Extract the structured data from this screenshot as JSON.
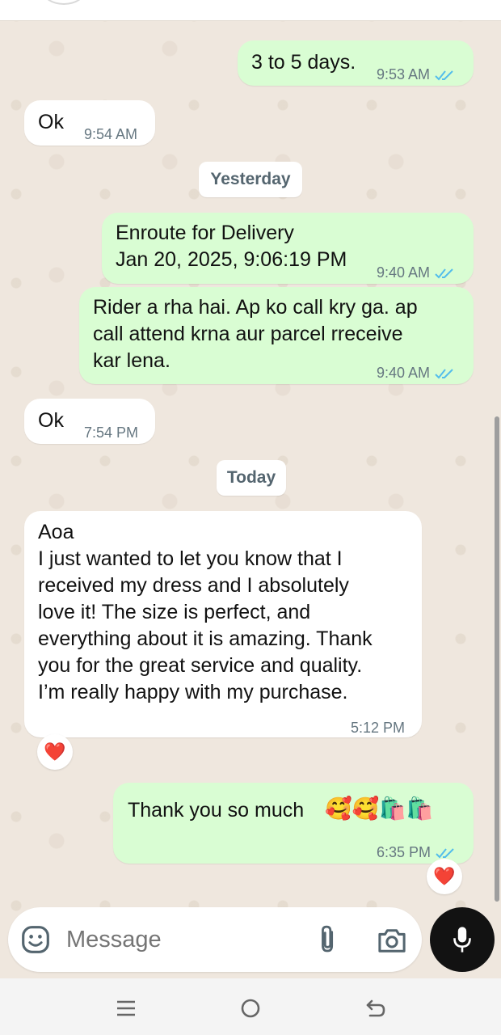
{
  "messages": [
    {
      "dir": "out",
      "text": "3 to 5 days.",
      "time": "9:53 AM"
    },
    {
      "dir": "in",
      "text": "Ok",
      "time": "9:54 AM"
    },
    {
      "dir": "out",
      "line1": "Enroute for Delivery",
      "line2": "Jan 20, 2025, 9:06:19 PM",
      "time": "9:40 AM"
    },
    {
      "dir": "out",
      "line1": "Rider a rha hai. Ap ko call kry ga. ap",
      "line2": "call attend krna aur parcel rreceive",
      "line3": "kar lena.",
      "time": "9:40 AM"
    },
    {
      "dir": "in",
      "text": "Ok",
      "time": "7:54 PM"
    },
    {
      "dir": "in",
      "lines": [
        "Aoa",
        "I just wanted to let you know that I",
        "received my dress and I absolutely",
        "love it! The size is perfect, and",
        "everything about it is amazing. Thank",
        "you for the great service and quality.",
        "I’m really happy with my purchase."
      ],
      "time": "5:12 PM",
      "reaction": "❤️"
    },
    {
      "dir": "out",
      "text": "Thank you so much",
      "emoji": "🥰🥰🛍️🛍️",
      "time": "6:35 PM",
      "reaction": "❤️"
    }
  ],
  "date_dividers": {
    "yesterday": "Yesterday",
    "today": "Today"
  },
  "input": {
    "placeholder": "Message"
  },
  "icons": {
    "emoji": "emoji-icon",
    "attach": "attach-icon",
    "camera": "camera-icon",
    "mic": "mic-icon",
    "read_ticks": "double-check-icon"
  },
  "colors": {
    "outgoing": "#d9fdd3",
    "incoming": "#ffffff",
    "ticks": "#53bdeb",
    "background": "#efe7de"
  }
}
